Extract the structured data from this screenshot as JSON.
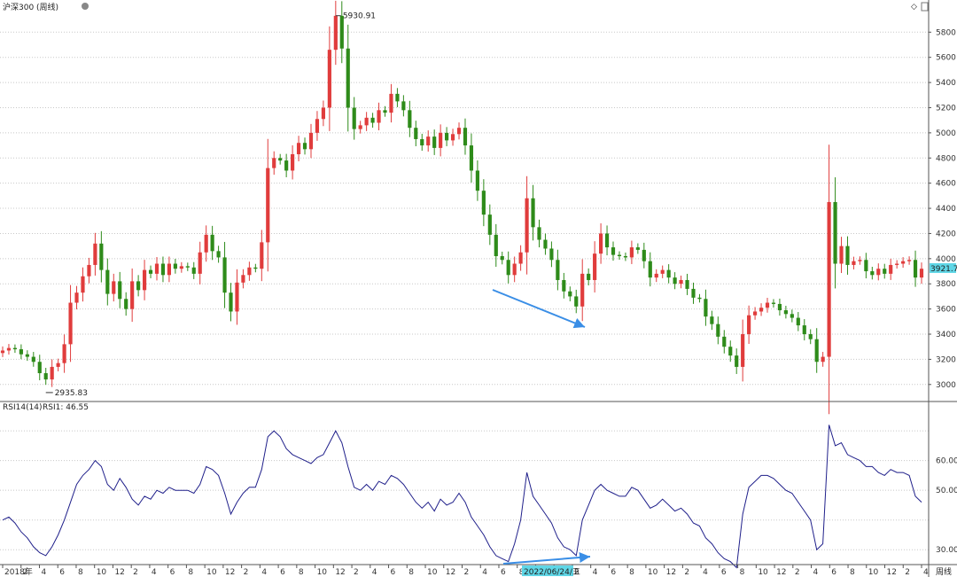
{
  "title": "沪深300 (周线)",
  "period_label": "周线",
  "colors": {
    "up": "#e03c3c",
    "down": "#2e8b1a",
    "rsi": "#1f1f8a",
    "arrow": "#3a8ee6",
    "price_tag": "#5fd6e6",
    "grid": "#c8c8c8"
  },
  "chart_data": [
    {
      "type": "candlestick",
      "title": "沪深300 (周线)",
      "ylim": [
        2900,
        5950
      ],
      "y_ticks": [
        3000,
        3200,
        3400,
        3600,
        3800,
        4000,
        4200,
        4400,
        4600,
        4800,
        5000,
        5200,
        5400,
        5600,
        5800
      ],
      "annotations": {
        "high": "5930.91",
        "low": "2935.83",
        "last_price": "3921.7"
      },
      "x_start": "2018-01",
      "closes": [
        3270,
        3290,
        3280,
        3240,
        3220,
        3180,
        3090,
        3040,
        3140,
        3170,
        3320,
        3650,
        3730,
        3860,
        3950,
        4120,
        3910,
        3720,
        3820,
        3680,
        3600,
        3820,
        3750,
        3910,
        3880,
        3960,
        3870,
        3960,
        3920,
        3940,
        3930,
        3880,
        4050,
        4190,
        4060,
        4010,
        3730,
        3580,
        3810,
        3870,
        3930,
        3920,
        4130,
        4720,
        4800,
        4780,
        4700,
        4830,
        4920,
        4870,
        5000,
        5110,
        5200,
        5660,
        5930,
        5670,
        5200,
        5030,
        5060,
        5120,
        5080,
        5180,
        5160,
        5310,
        5250,
        5180,
        5040,
        4950,
        4900,
        4970,
        4880,
        5000,
        4940,
        4990,
        5040,
        4900,
        4700,
        4540,
        4350,
        4190,
        4020,
        3990,
        3870,
        3960,
        4050,
        4480,
        4250,
        4150,
        4080,
        3990,
        3830,
        3740,
        3700,
        3620,
        3880,
        3830,
        4040,
        4200,
        4090,
        4030,
        4020,
        4010,
        4090,
        4070,
        3980,
        3850,
        3880,
        3910,
        3850,
        3800,
        3830,
        3760,
        3690,
        3680,
        3540,
        3480,
        3380,
        3300,
        3230,
        3140,
        3400,
        3550,
        3580,
        3610,
        3650,
        3640,
        3590,
        3560,
        3530,
        3470,
        3400,
        3360,
        3180,
        3220,
        4450,
        3960,
        4100,
        3950,
        3980,
        3990,
        3900,
        3870,
        3920,
        3880,
        3950,
        3960,
        3980,
        3990,
        3850,
        3920
      ],
      "rsi_series": [
        {
          "name": "RSI14(14)",
          "label": "RSI1: 46.55",
          "ylim": [
            25,
            76
          ],
          "y_ticks": [
            30,
            50,
            60
          ],
          "y_tick_labels": [
            "30.00",
            "50.00",
            "60.00"
          ],
          "values": [
            40,
            41,
            39,
            36,
            34,
            31,
            29,
            28,
            31,
            35,
            40,
            46,
            52,
            55,
            57,
            60,
            58,
            52,
            50,
            54,
            51,
            47,
            45,
            48,
            47,
            50,
            49,
            51,
            50,
            50,
            50,
            49,
            52,
            58,
            57,
            55,
            49,
            42,
            46,
            49,
            51,
            51,
            57,
            68,
            70,
            68,
            64,
            62,
            61,
            60,
            59,
            61,
            62,
            66,
            70,
            66,
            58,
            51,
            50,
            52,
            50,
            53,
            52,
            55,
            54,
            52,
            49,
            46,
            44,
            46,
            43,
            47,
            45,
            46,
            49,
            46,
            41,
            38,
            35,
            31,
            28,
            27,
            26,
            32,
            40,
            56,
            48,
            45,
            42,
            39,
            34,
            31,
            30,
            28,
            40,
            45,
            50,
            52,
            50,
            49,
            48,
            48,
            51,
            50,
            47,
            44,
            45,
            47,
            45,
            43,
            44,
            42,
            39,
            38,
            34,
            32,
            29,
            27,
            26,
            24,
            42,
            51,
            53,
            55,
            55,
            54,
            52,
            50,
            49,
            46,
            43,
            40,
            30,
            32,
            72,
            65,
            66,
            62,
            61,
            60,
            58,
            58,
            56,
            55,
            57,
            56,
            56,
            55,
            48,
            46
          ]
        }
      ],
      "x_tick_labels": [
        "2018年",
        "2",
        "4",
        "6",
        "8",
        "10",
        "12",
        "2",
        "4",
        "6",
        "8",
        "10",
        "12",
        "2",
        "4",
        "6",
        "8",
        "10",
        "12",
        "2",
        "4",
        "6",
        "8",
        "10",
        "12",
        "2",
        "4",
        "6",
        "8",
        "10",
        "12",
        "2",
        "4",
        "6",
        "8",
        "10",
        "12",
        "2",
        "4",
        "6",
        "8",
        "10",
        "12",
        "2",
        "4",
        "6",
        "8",
        "10",
        "12",
        "2",
        "4"
      ],
      "cursor_date": "2022/06/24/五"
    }
  ]
}
